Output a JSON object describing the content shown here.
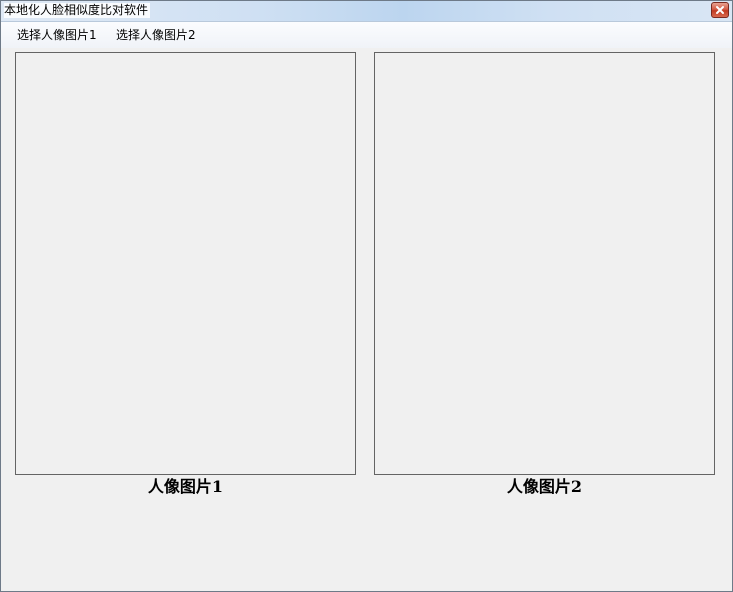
{
  "window": {
    "title": "本地化人脸相似度比对软件"
  },
  "menu": {
    "items": [
      {
        "label": "选择人像图片1"
      },
      {
        "label": "选择人像图片2"
      }
    ]
  },
  "panels": [
    {
      "caption": "人像图片1"
    },
    {
      "caption": "人像图片2"
    }
  ],
  "icons": {
    "close": "close-icon"
  },
  "colors": {
    "close_button": "#c94a33",
    "window_background": "#f0f0f0",
    "image_border": "#646464"
  }
}
